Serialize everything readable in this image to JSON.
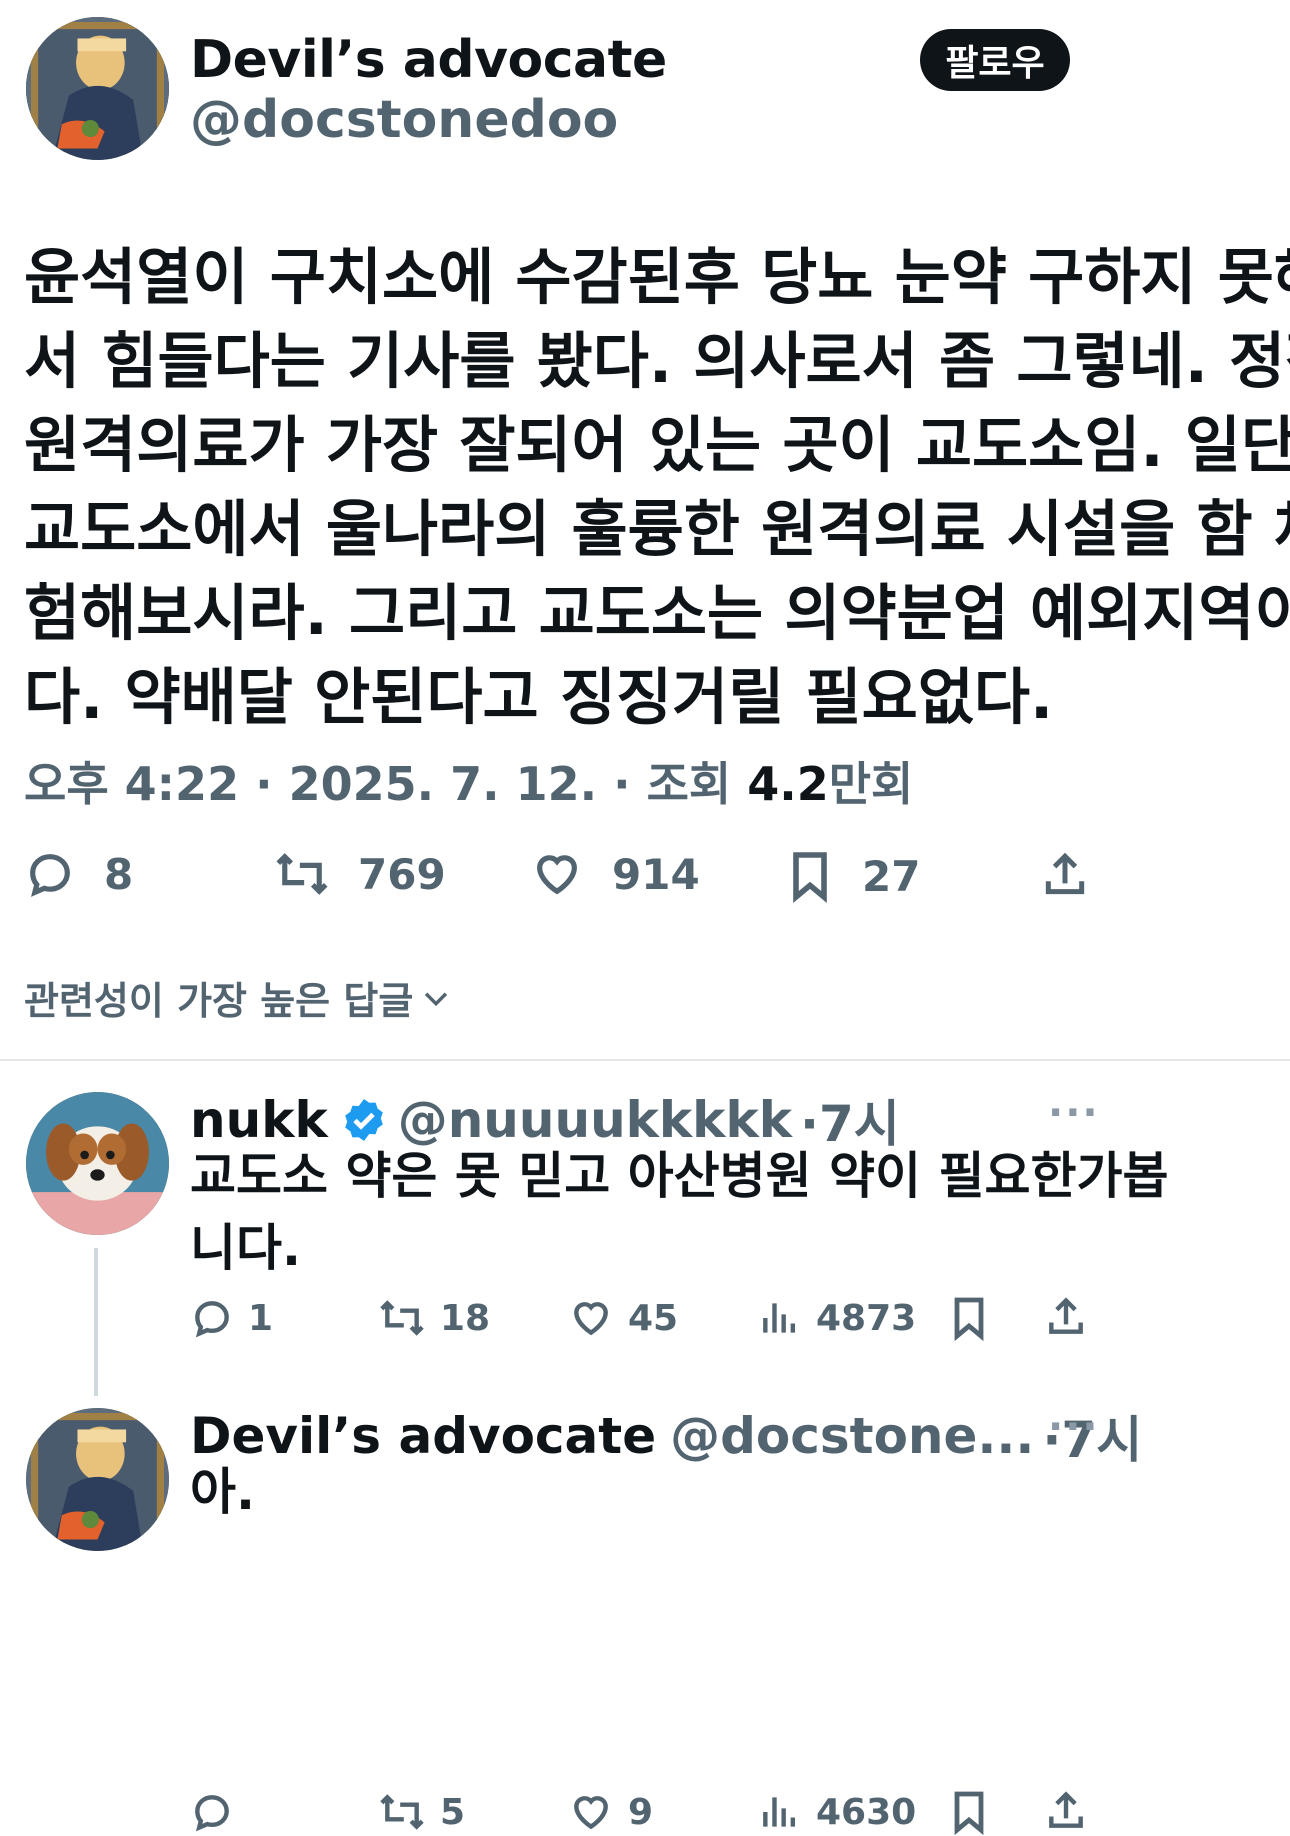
{
  "main_post": {
    "author_name": "Devil’s advocate",
    "author_handle": "@docstonedoo",
    "follow_label": "팔로우",
    "text_lines": [
      "윤석열이 구치소에 수감된후 당뇨 눈약 구하지 못해",
      "서 힘들다는 기사를 봤다. 의사로서 좀 그렇네. 정작",
      "원격의료가 가장 잘되어 있는 곳이 교도소임.  일단",
      "교도소에서 울나라의 훌륭한 원격의료 시설을 함 체",
      "험해보시라. 그리고 교도소는 의약분업 예외지역이",
      "다. 약배달 안된다고 징징거릴 필요없다."
    ],
    "meta_time": "오후 4:22 · 2025. 7. 12. · 조회 ",
    "meta_views": "4.2",
    "meta_views_suffix": "만회",
    "actions": {
      "replies": "8",
      "reposts": "769",
      "likes": "914",
      "bookmarks": "27"
    }
  },
  "sort_label": "관련성이 가장 높은 답글",
  "replies": [
    {
      "author_name": "nukk",
      "verified": true,
      "author_handle": "@nuuuukkkkk",
      "time": "·7시",
      "text_lines": [
        "교도소 약은 못 믿고 아산병원 약이 필요한가봅",
        "니다."
      ],
      "actions": {
        "replies": "1",
        "reposts": "18",
        "likes": "45",
        "views": "4873"
      }
    },
    {
      "author_name": "Devil’s advocate",
      "author_handle": "@docstone...",
      "time": "·7시",
      "text_lines": [
        "아."
      ],
      "actions": {
        "replies": "",
        "reposts": "5",
        "likes": "9",
        "views": "4630"
      }
    }
  ],
  "colors": {
    "text": "#0f1419",
    "secondary": "#536471",
    "verified": "#1d9bf0",
    "divider": "#e3e7ea"
  }
}
